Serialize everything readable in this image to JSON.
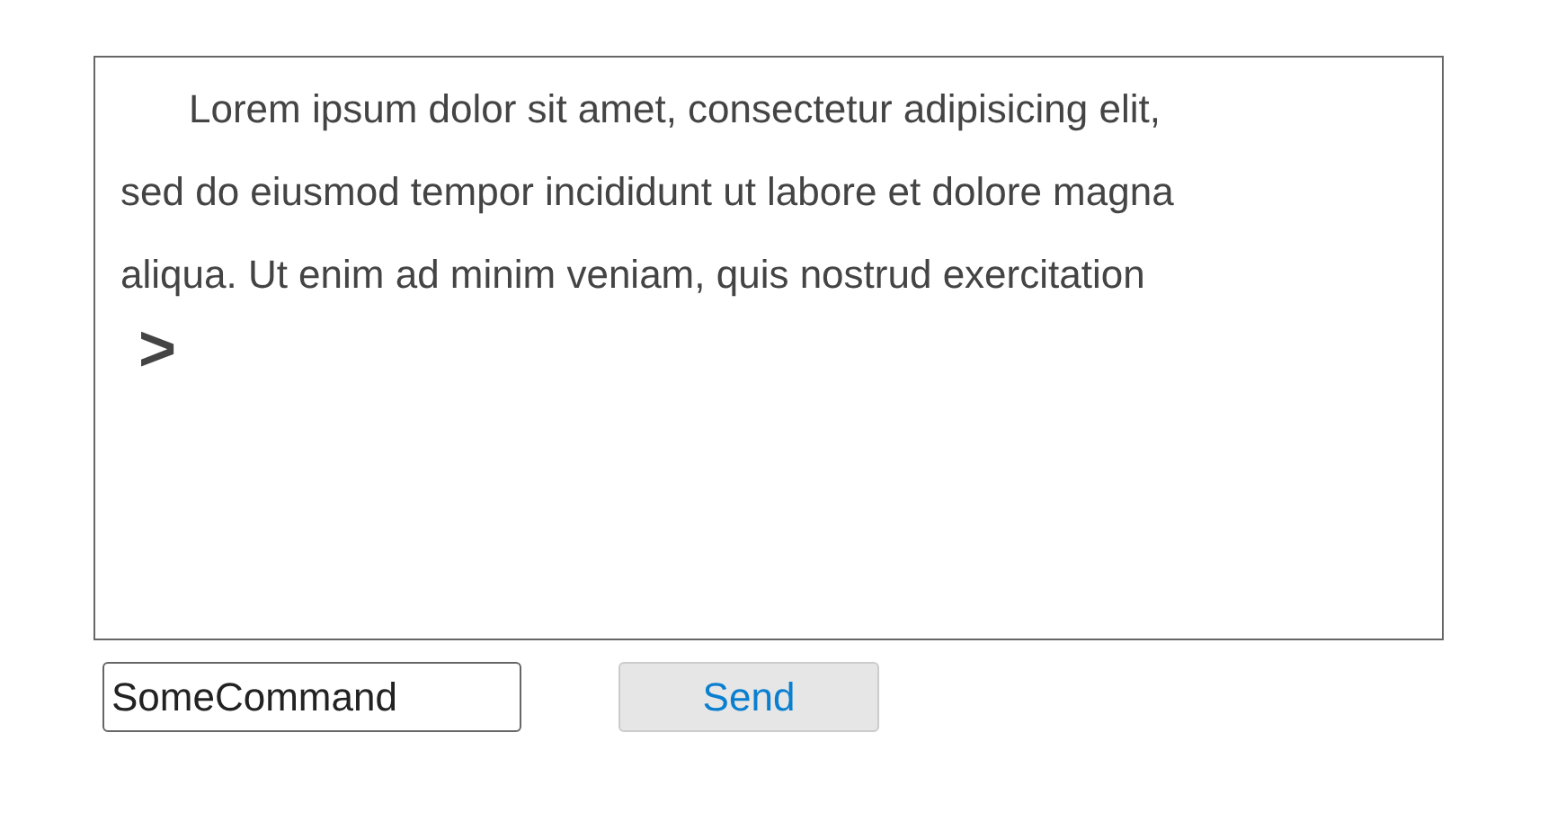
{
  "console": {
    "lines": [
      "Lorem ipsum dolor sit amet, consectetur adipisicing elit,",
      "sed do eiusmod tempor incididunt ut labore et dolore magna",
      "aliqua. Ut enim ad minim veniam, quis nostrud exercitation"
    ],
    "prompt": ">"
  },
  "command": {
    "value": "SomeCommand"
  },
  "send_button": {
    "label": "Send"
  }
}
